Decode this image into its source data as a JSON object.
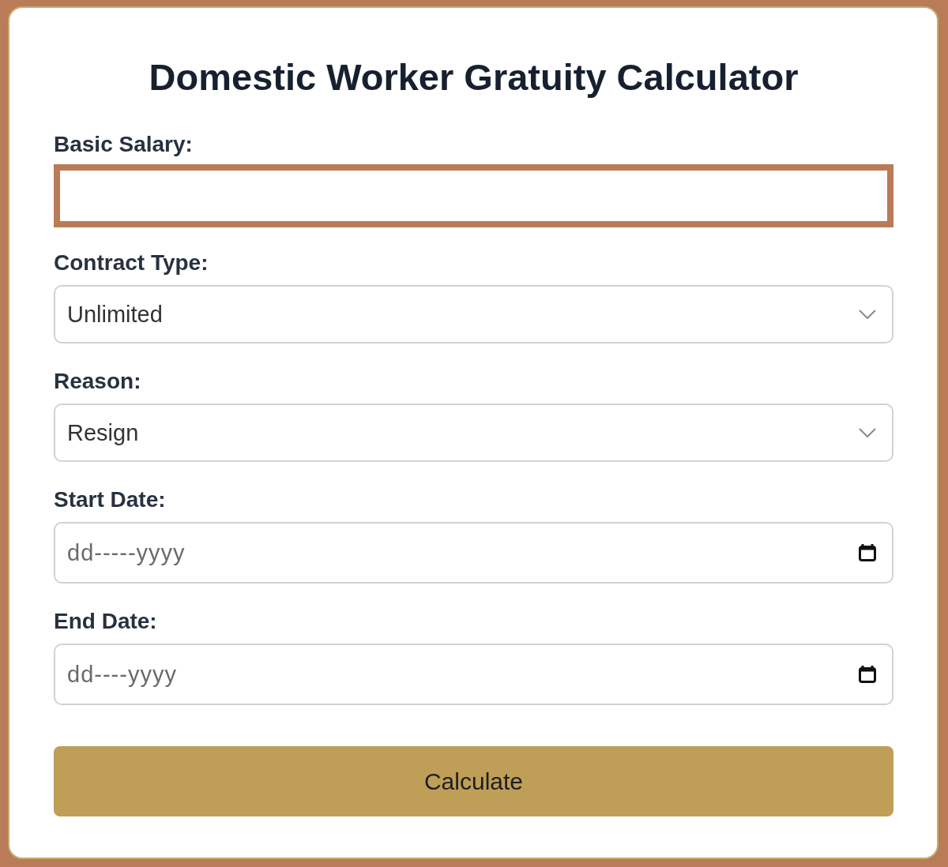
{
  "title": "Domestic Worker Gratuity Calculator",
  "fields": [
    {
      "kind": "text",
      "label": "Basic Salary:",
      "focused": true
    },
    {
      "kind": "select",
      "label": "Contract Type:",
      "value": "Unlimited",
      "focused": false
    },
    {
      "kind": "select",
      "label": "Reason:",
      "value": "Resign",
      "focused": false
    },
    {
      "kind": "date",
      "label": "Start Date:",
      "placeholder": "dd-----yyyy",
      "focused": false
    },
    {
      "kind": "date",
      "label": "End Date:",
      "placeholder": "dd----yyyy",
      "focused": false
    }
  ],
  "button": {
    "label": "Calculate"
  }
}
